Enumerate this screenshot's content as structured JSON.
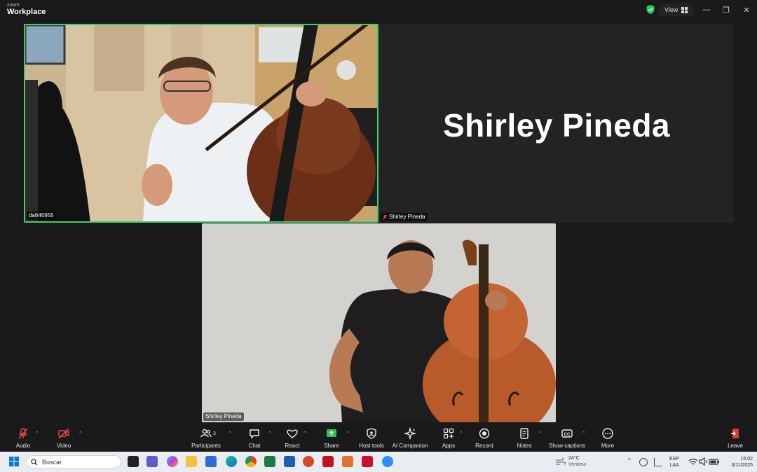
{
  "window": {
    "brand_top": "zoom",
    "brand_main": "Workplace",
    "view_label": "View",
    "controls": [
      "—",
      "❐",
      "✕"
    ]
  },
  "tiles": {
    "tile1_name": "da646955",
    "tile2_big_name": "Shirley Pineda",
    "tile2_name": "Shirley Pineda",
    "tile3_name": "Shirley Pineda"
  },
  "toolbar": {
    "audio": "Audio",
    "video": "Video",
    "participants": "Participants",
    "participants_count": "3",
    "chat": "Chat",
    "react": "React",
    "share": "Share",
    "host_tools": "Host tools",
    "ai_companion": "AI Companion",
    "apps": "Apps",
    "record": "Record",
    "notes": "Notes",
    "show_captions": "Show captions",
    "more": "More",
    "leave": "Leave"
  },
  "taskbar": {
    "search_placeholder": "Buscar",
    "weather_temp": "24°C",
    "weather_desc": "Ventoso",
    "lang_1": "ESP",
    "lang_2": "LAA",
    "time": "15:02",
    "date": "3/11/2025"
  },
  "colors": {
    "active_speaker_border": "#3ecf6b",
    "share_green": "#2ec45e",
    "muted_red": "#e5484d",
    "leave_red": "#d93a3a"
  }
}
